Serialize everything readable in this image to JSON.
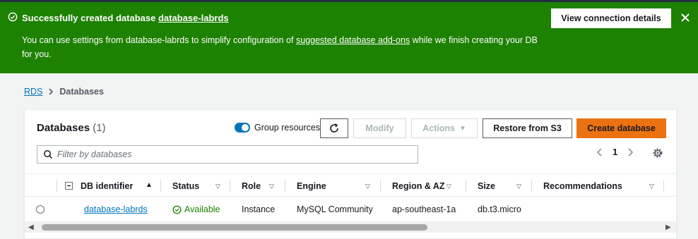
{
  "flash": {
    "title_prefix": "Successfully created database",
    "db_name": "database-labrds",
    "body_prefix": "You can use settings from database-labrds to simplify configuration of",
    "body_link": "suggested database add-ons",
    "body_suffix": "while we finish creating your DB for you.",
    "view_button": "View connection details",
    "close_icon": "close-icon",
    "success_icon": "check-circle-icon",
    "color": "#1d8102"
  },
  "breadcrumb": {
    "root": "RDS",
    "current": "Databases"
  },
  "panel": {
    "title": "Databases",
    "count": "(1)",
    "group_label": "Group resources",
    "buttons": {
      "refresh_icon": "refresh-icon",
      "modify": "Modify",
      "actions": "Actions",
      "restore": "Restore from S3",
      "create": "Create database"
    },
    "search_placeholder": "Filter by databases",
    "page": "1",
    "accent": "#ec7211"
  },
  "table": {
    "columns": [
      "DB identifier",
      "Status",
      "Role",
      "Engine",
      "Region & AZ",
      "Size",
      "Recommendations"
    ],
    "rows": [
      {
        "identifier": "database-labrds",
        "status": "Available",
        "role": "Instance",
        "engine": "MySQL Community",
        "region": "ap-southeast-1a",
        "size": "db.t3.micro",
        "recommendations": ""
      }
    ]
  }
}
